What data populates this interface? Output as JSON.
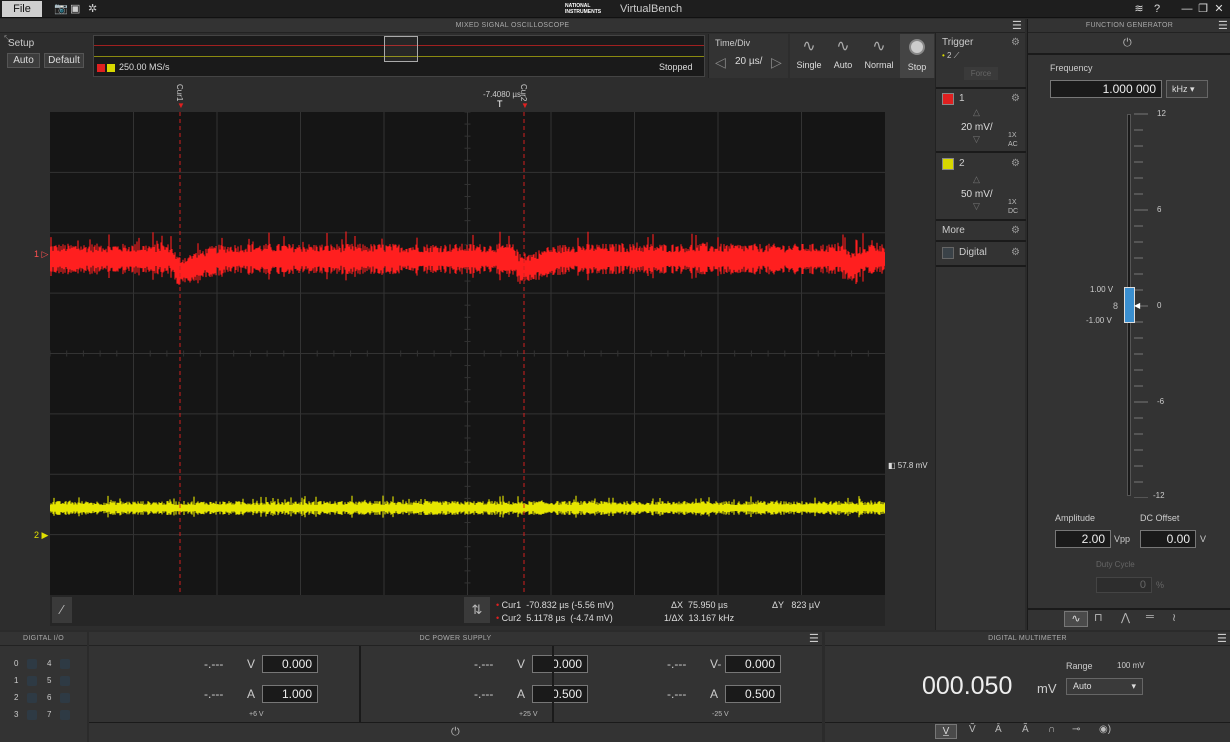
{
  "titlebar": {
    "file": "File",
    "title": "VirtualBench",
    "brand": "NATIONAL INSTRUMENTS",
    "camera_icon": "camera-icon",
    "settings_icon": "network-icon",
    "wifi": "wifi-icon",
    "help": "?",
    "minimize": "—",
    "restore": "❐",
    "close": "✕"
  },
  "scope": {
    "header": "MIXED SIGNAL OSCILLOSCOPE",
    "setup": "Setup",
    "auto": "Auto",
    "default": "Default",
    "samplerate": "250.00 MS/s",
    "status": "Stopped",
    "timediv_label": "Time/Div",
    "timediv_value": "20 µs/",
    "modes": [
      "Single",
      "Auto",
      "Normal",
      "Stop"
    ],
    "cursor1_label": "Cur1",
    "cursor2_label": "Cur2",
    "cursor2_time": "-7.4080 µs",
    "ch1_marker": "1",
    "ch2_marker": "2",
    "trigger_level": "57.8 mV",
    "readout": {
      "cur1_label": "Cur1",
      "cur1_value": "-70.832 µs (-5.56 mV)",
      "cur2_label": "Cur2",
      "cur2_value": "5.1178 µs  (-4.74 mV)",
      "dx_label": "ΔX",
      "dx_value": "75.950 µs",
      "inv_dx_label": "1/ΔX",
      "inv_dx_value": "13.167 kHz",
      "dy_label": "ΔY",
      "dy_value": "823 µV"
    }
  },
  "sidepanel": {
    "trigger_label": "Trigger",
    "trigger_src": "2",
    "force": "Force",
    "ch1": {
      "name": "1",
      "scale": "20 mV/",
      "probe": "1X",
      "coupling": "AC",
      "color": "#e02020"
    },
    "ch2": {
      "name": "2",
      "scale": "50 mV/",
      "probe": "1X",
      "coupling": "DC",
      "color": "#d8d800"
    },
    "more": "More",
    "digital": "Digital"
  },
  "fgen": {
    "header": "FUNCTION GENERATOR",
    "frequency_label": "Frequency",
    "frequency_value": "1.000 000",
    "frequency_unit": "kHz",
    "ticks": [
      "12",
      "6",
      "0",
      "-6",
      "-12"
    ],
    "high_label": "1.00 V",
    "low_label": "-1.00 V",
    "amplitude_label": "Amplitude",
    "amplitude_value": "2.00",
    "amplitude_unit": "Vpp",
    "offset_label": "DC Offset",
    "offset_value": "0.00",
    "offset_unit": "V",
    "duty_label": "Duty Cycle",
    "duty_value": "0",
    "duty_unit": "%"
  },
  "dio": {
    "header": "DIGITAL I/O",
    "left": [
      "0",
      "1",
      "2",
      "3"
    ],
    "right": [
      "4",
      "5",
      "6",
      "7"
    ]
  },
  "dcps": {
    "header": "DC POWER SUPPLY",
    "channels": [
      {
        "v_meas": "-.---",
        "v_unit": "V",
        "v_set": "0.000",
        "a_meas": "-.---",
        "a_unit": "A",
        "a_set": "1.000",
        "name": "+6 V"
      },
      {
        "v_meas": "-.---",
        "v_unit": "V",
        "v_set": "0.000",
        "a_meas": "-.---",
        "a_unit": "A",
        "a_set": "0.500",
        "name": "+25 V"
      },
      {
        "v_meas": "-.---",
        "v_unit": "V-",
        "v_set": "0.000",
        "a_meas": "-.---",
        "a_unit": "A",
        "a_set": "0.500",
        "name": "-25 V"
      }
    ]
  },
  "dmm": {
    "header": "DIGITAL MULTIMETER",
    "value": "000.050",
    "unit": "mV",
    "range_label": "Range",
    "range_value": "100 mV",
    "range_select": "Auto"
  }
}
